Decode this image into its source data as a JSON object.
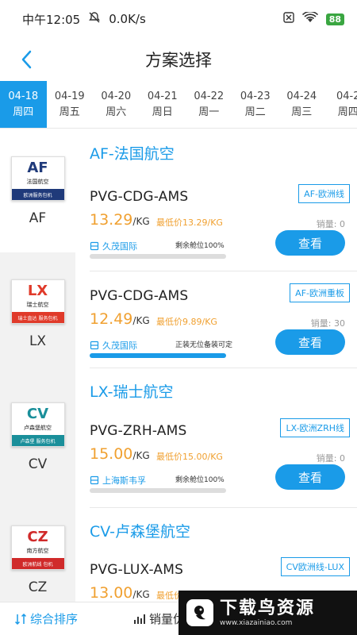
{
  "status": {
    "time": "中午12:05",
    "speed": "0.0K/s",
    "battery": "88"
  },
  "header": {
    "title": "方案选择"
  },
  "dates": [
    {
      "date": "04-18",
      "weekday": "周四",
      "active": true
    },
    {
      "date": "04-19",
      "weekday": "周五"
    },
    {
      "date": "04-20",
      "weekday": "周六"
    },
    {
      "date": "04-21",
      "weekday": "周日"
    },
    {
      "date": "04-22",
      "weekday": "周一"
    },
    {
      "date": "04-23",
      "weekday": "周二"
    },
    {
      "date": "04-24",
      "weekday": "周三"
    },
    {
      "date": "04-2",
      "weekday": "周四"
    }
  ],
  "sidebar": [
    {
      "code": "AF",
      "cn": "法国航空",
      "band": "欧洲服务包机",
      "label": "AF",
      "color": "#1f3a7a"
    },
    {
      "code": "LX",
      "cn": "瑞士航空",
      "band": "瑞士直达 服务包机",
      "label": "LX",
      "color": "#e03a2a"
    },
    {
      "code": "CV",
      "cn": "卢森堡航空",
      "band": "卢森堡 服务包机",
      "label": "CV",
      "color": "#1a8f9a"
    },
    {
      "code": "CZ",
      "cn": "南方航空",
      "band": "欧洲航线 包机",
      "label": "CZ",
      "color": "#d02a2a"
    }
  ],
  "sections": [
    {
      "title": "AF-法国航空",
      "cards": [
        {
          "route": "PVG-CDG-AMS",
          "tag": "AF-欧洲线",
          "price": "13.29",
          "unit": "/KG",
          "min": "最低价13.29/KG",
          "sales": "销量: 0",
          "agent": "久茂国际",
          "remain": "剩余舱位100%",
          "progress": 0,
          "btn": "查看"
        },
        {
          "route": "PVG-CDG-AMS",
          "tag": "AF-欧洲重板",
          "price": "12.49",
          "unit": "/KG",
          "min": "最低价9.89/KG",
          "sales": "销量: 30",
          "agent": "久茂国际",
          "remain": "正装无位备装可定",
          "progress": 100,
          "btn": "查看"
        }
      ]
    },
    {
      "title": "LX-瑞士航空",
      "cards": [
        {
          "route": "PVG-ZRH-AMS",
          "tag": "LX-欧洲ZRH线",
          "price": "15.00",
          "unit": "/KG",
          "min": "最低价15.00/KG",
          "sales": "销量: 0",
          "agent": "上海斯韦孚",
          "remain": "剩余舱位100%",
          "progress": 0,
          "btn": "查看"
        }
      ]
    },
    {
      "title": "CV-卢森堡航空",
      "cards": [
        {
          "route": "PVG-LUX-AMS",
          "tag": "CV欧洲线-LUX",
          "price": "13.00",
          "unit": "/KG",
          "min": "最低价",
          "sales": "",
          "agent": "",
          "remain": "",
          "progress": 0,
          "btn": ""
        }
      ]
    }
  ],
  "bottom": {
    "sort": "综合排序",
    "sales": "销量优"
  },
  "watermark": {
    "title": "下载鸟资源",
    "url": "www.xiazainiao.com"
  }
}
